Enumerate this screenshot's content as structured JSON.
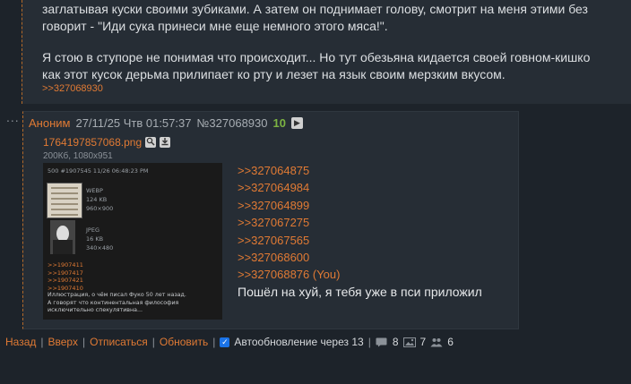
{
  "previous_post": {
    "line1": "заглатывая куски своими зубиками. А затем он поднимает голову, смотрит на меня этими без",
    "line2": "говорит - \"Иди сука принеси мне еще немного этого мяса!\".",
    "line3": "Я стою в ступоре не понимая что происходит... Но тут обезьяна кидается своей говном-кишко",
    "line4": "как этот кусок дерьма прилипает ко рту и лезет на язык своим мерзким вкусом.",
    "reply_link": ">>327068930"
  },
  "thread_ellipsis": "...",
  "post": {
    "author": "Аноним",
    "datetime": "27/11/25 Чтв 01:57:37",
    "number": "№327068930",
    "likes": "10",
    "play_icon": "play-icon",
    "file": {
      "name": "1764197857068.png",
      "size": "200Кб, 1080x951",
      "search_icon": "search-icon",
      "download_icon": "download-icon"
    },
    "thumbnail": {
      "header": "500 #1907545 11/26 06:48:23 PM",
      "img1_meta": [
        "WEBP",
        "124 KB",
        "960×900"
      ],
      "img2_meta": [
        "JPEG",
        "16 KB",
        "340×480"
      ],
      "links": [
        ">>1907411",
        ">>1907417",
        ">>1907421",
        ">>1907410"
      ],
      "text": [
        "Иллюстрация, о чём писал Фуко 50 лет назад.",
        "А говорят что континентальная философия",
        "исключительно спекулятивна..."
      ]
    },
    "replies": [
      ">>327064875",
      ">>327064984",
      ">>327064899",
      ">>327067275",
      ">>327067565",
      ">>327068600",
      ">>327068876 (You)"
    ],
    "text": "Пошёл на хуй, я тебя уже в пси приложил"
  },
  "bottom_bar": {
    "back": "Назад",
    "top": "Вверх",
    "unsubscribe": "Отписаться",
    "refresh": "Обновить",
    "autorefresh_label": "Автообновление через 13",
    "autorefresh_checked": true,
    "posts_count": "8",
    "images_count": "7",
    "posters_count": "6"
  },
  "colors": {
    "background": "#1d232a",
    "post_bg": "#262d35",
    "accent": "#e07a34",
    "likes": "#7cb342"
  }
}
